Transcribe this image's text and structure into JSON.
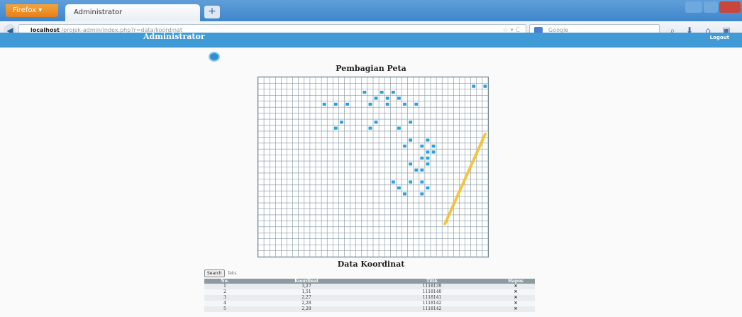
{
  "browser": {
    "firefox_label": "Firefox",
    "tab_title": "Administrator",
    "url_host": "localhost",
    "url_path": "/projek-admin/index.php?r=data/koordinat",
    "search_placeholder": "Google"
  },
  "header": {
    "title": "Administrator",
    "logout_label": "Logout"
  },
  "map": {
    "title": "Pembagian Peta",
    "grid_cols": 40,
    "grid_rows": 30,
    "marker_color": "#29a3d8",
    "route_color": "#f2c12e",
    "markers": [
      [
        37,
        1
      ],
      [
        39,
        1
      ],
      [
        18,
        2
      ],
      [
        21,
        2
      ],
      [
        23,
        2
      ],
      [
        20,
        3
      ],
      [
        22,
        3
      ],
      [
        24,
        3
      ],
      [
        11,
        4
      ],
      [
        13,
        4
      ],
      [
        15,
        4
      ],
      [
        19,
        4
      ],
      [
        22,
        4
      ],
      [
        25,
        4
      ],
      [
        27,
        4
      ],
      [
        14,
        7
      ],
      [
        20,
        7
      ],
      [
        26,
        7
      ],
      [
        13,
        8
      ],
      [
        19,
        8
      ],
      [
        24,
        8
      ],
      [
        26,
        10
      ],
      [
        29,
        10
      ],
      [
        25,
        11
      ],
      [
        28,
        11
      ],
      [
        30,
        11
      ],
      [
        29,
        12
      ],
      [
        30,
        12
      ],
      [
        28,
        13
      ],
      [
        29,
        13
      ],
      [
        26,
        14
      ],
      [
        29,
        14
      ],
      [
        27,
        15
      ],
      [
        28,
        15
      ],
      [
        23,
        17
      ],
      [
        26,
        17
      ],
      [
        28,
        17
      ],
      [
        24,
        18
      ],
      [
        29,
        18
      ],
      [
        25,
        19
      ],
      [
        28,
        19
      ]
    ],
    "route_start": [
      32,
      24
    ],
    "route_end": [
      39,
      9
    ]
  },
  "data_section": {
    "title": "Data Koordinat",
    "search_button": "Search",
    "search_placeholder": "Teks"
  },
  "table": {
    "headers": [
      "No.",
      "Koordinat",
      "Titik",
      "Hapus"
    ],
    "rows": [
      {
        "no": "1",
        "koordinat": "3,27",
        "titik": "1118139",
        "hapus": "✕"
      },
      {
        "no": "2",
        "koordinat": "1,51",
        "titik": "1118140",
        "hapus": "✕"
      },
      {
        "no": "3",
        "koordinat": "2,27",
        "titik": "1118141",
        "hapus": "✕"
      },
      {
        "no": "4",
        "koordinat": "2,28",
        "titik": "1118142",
        "hapus": "✕"
      },
      {
        "no": "5",
        "koordinat": "2,28",
        "titik": "1118142",
        "hapus": "✕"
      }
    ]
  }
}
